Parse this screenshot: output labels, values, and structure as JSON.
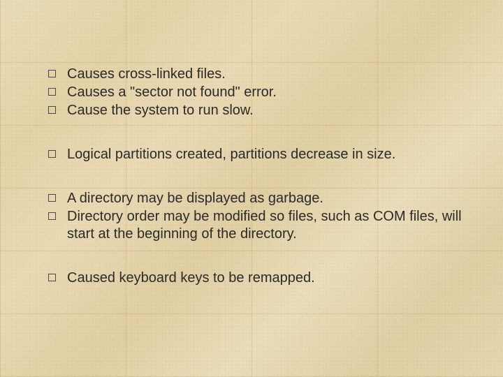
{
  "groups": [
    {
      "items": [
        "Causes cross-linked files.",
        "Causes a \"sector not found\" error.",
        "Cause the system to run slow."
      ]
    },
    {
      "items": [
        "Logical partitions created, partitions decrease in size."
      ]
    },
    {
      "items": [
        "A directory may be displayed as garbage.",
        "Directory order may be modified so files, such as COM files, will start at the beginning of the directory."
      ]
    },
    {
      "items": [
        "Caused keyboard keys to be remapped."
      ]
    }
  ]
}
